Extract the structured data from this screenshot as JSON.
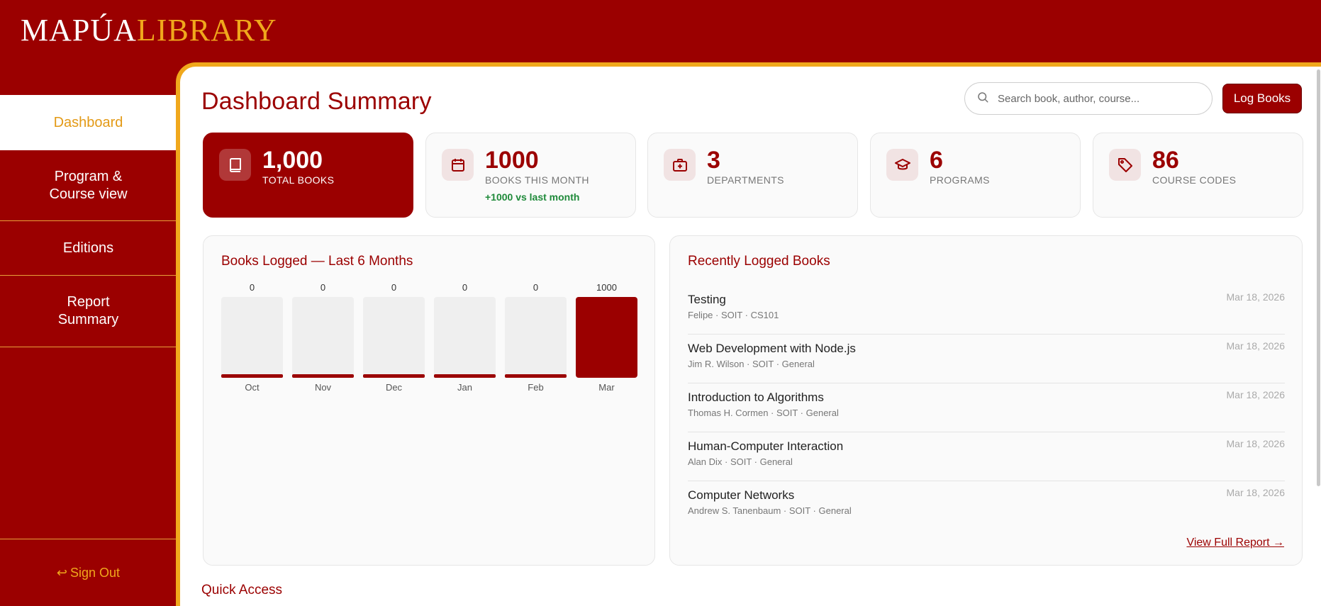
{
  "app": {
    "logo_brand": "MAPÚA",
    "logo_library": "LIBRARY"
  },
  "sidebar": {
    "items": [
      {
        "label": "Dashboard",
        "active": true
      },
      {
        "label": "Program &\nCourse view"
      },
      {
        "label": "Editions"
      },
      {
        "label": "Report\nSummary"
      }
    ],
    "signout_label": "Sign Out",
    "signout_icon": "return-arrow-icon"
  },
  "header": {
    "title": "Dashboard Summary",
    "search_placeholder": "Search book, author, course...",
    "log_button": "Log Books"
  },
  "stats": [
    {
      "value": "1,000",
      "label": "TOTAL BOOKS",
      "icon": "book-icon",
      "primary": true
    },
    {
      "value": "1000",
      "label": "BOOKS THIS MONTH",
      "icon": "calendar-icon",
      "delta": "+1000 vs last month"
    },
    {
      "value": "3",
      "label": "DEPARTMENTS",
      "icon": "briefcase-plus-icon"
    },
    {
      "value": "6",
      "label": "PROGRAMS",
      "icon": "graduation-cap-icon"
    },
    {
      "value": "86",
      "label": "COURSE CODES",
      "icon": "tag-icon"
    }
  ],
  "chart_panel": {
    "title": "Books Logged — Last 6 Months"
  },
  "chart_data": {
    "type": "bar",
    "title": "Books Logged — Last 6 Months",
    "categories": [
      "Oct",
      "Nov",
      "Dec",
      "Jan",
      "Feb",
      "Mar"
    ],
    "values": [
      0,
      0,
      0,
      0,
      0,
      1000
    ],
    "ylim": [
      0,
      1000
    ],
    "grid": false,
    "colors": {
      "bar": "#9b0000",
      "track": "#efefef"
    }
  },
  "recent": {
    "title": "Recently Logged Books",
    "items": [
      {
        "title": "Testing",
        "sub": "Felipe · SOIT · CS101",
        "date": "Mar 18, 2026"
      },
      {
        "title": "Web Development with Node.js",
        "sub": "Jim R. Wilson · SOIT · General",
        "date": "Mar 18, 2026"
      },
      {
        "title": "Introduction to Algorithms",
        "sub": "Thomas H. Cormen · SOIT · General",
        "date": "Mar 18, 2026"
      },
      {
        "title": "Human-Computer Interaction",
        "sub": "Alan Dix · SOIT · General",
        "date": "Mar 18, 2026"
      },
      {
        "title": "Computer Networks",
        "sub": "Andrew S. Tanenbaum · SOIT · General",
        "date": "Mar 18, 2026"
      }
    ],
    "view_full": "View Full Report →"
  },
  "quick_access": {
    "title": "Quick Access"
  },
  "colors": {
    "brand_red": "#9b0000",
    "accent_gold": "#f0a81c",
    "delta_green": "#1f8a3a"
  }
}
